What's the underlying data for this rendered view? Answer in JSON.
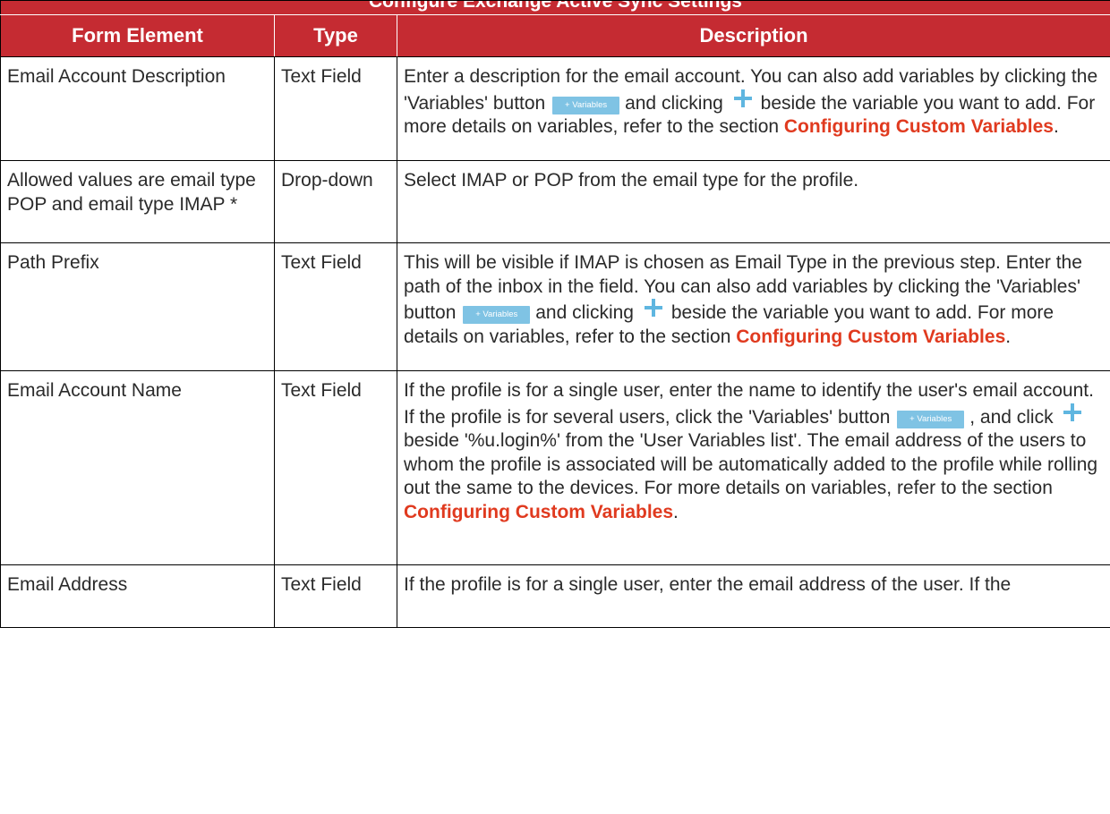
{
  "table": {
    "caption": "Configure Exchange Active Sync Settings",
    "headers": {
      "element": "Form Element",
      "type": "Type",
      "description": "Description"
    },
    "variables_button_label": "+ Variables",
    "rows": [
      {
        "element": "Email Account Description",
        "type": "Text Field",
        "desc": {
          "p1": "Enter a description for the email account. You can also add variables by clicking the 'Variables' button",
          "p2": "and clicking",
          "p3": "beside the variable you want to add. For more details on variables, refer to the section",
          "link": "Configuring Custom Variables",
          "end": "."
        }
      },
      {
        "element": "Allowed values are email type POP and email type IMAP *",
        "type": "Drop-down",
        "desc": {
          "text": "Select IMAP or POP from the email type for the profile."
        }
      },
      {
        "element": "Path Prefix",
        "type": "Text Field",
        "desc": {
          "p1": "This will be visible if IMAP is chosen as Email Type in the previous step. Enter the path of the inbox in the field. You can also add variables by clicking the 'Variables' button",
          "p2": "and clicking",
          "p3": "beside the variable you want to add. For more details on variables, refer to the section",
          "link": "Configuring Custom Variables",
          "end": "."
        }
      },
      {
        "element": "Email Account Name",
        "type": "Text Field",
        "desc": {
          "p1": "If the profile is for a single user, enter the name to identify the user's email account. If the profile is for several users, click the 'Variables' button",
          "p2": ", and click",
          "p3": "beside '%u.login%' from the 'User Variables list'. The email address of the users to whom the profile is associated will be automatically added to the profile while rolling out the same to the devices. For more details on variables, refer to the section",
          "link": "Configuring Custom Variables",
          "end": "."
        }
      },
      {
        "element": "Email Address",
        "type": "Text Field",
        "desc": {
          "text": "If the profile is for a single user, enter the email address of the user. If the"
        }
      }
    ]
  },
  "colors": {
    "header_bg": "#c52b32",
    "link": "#e03a1f",
    "variables_button": "#7fc3e4"
  }
}
